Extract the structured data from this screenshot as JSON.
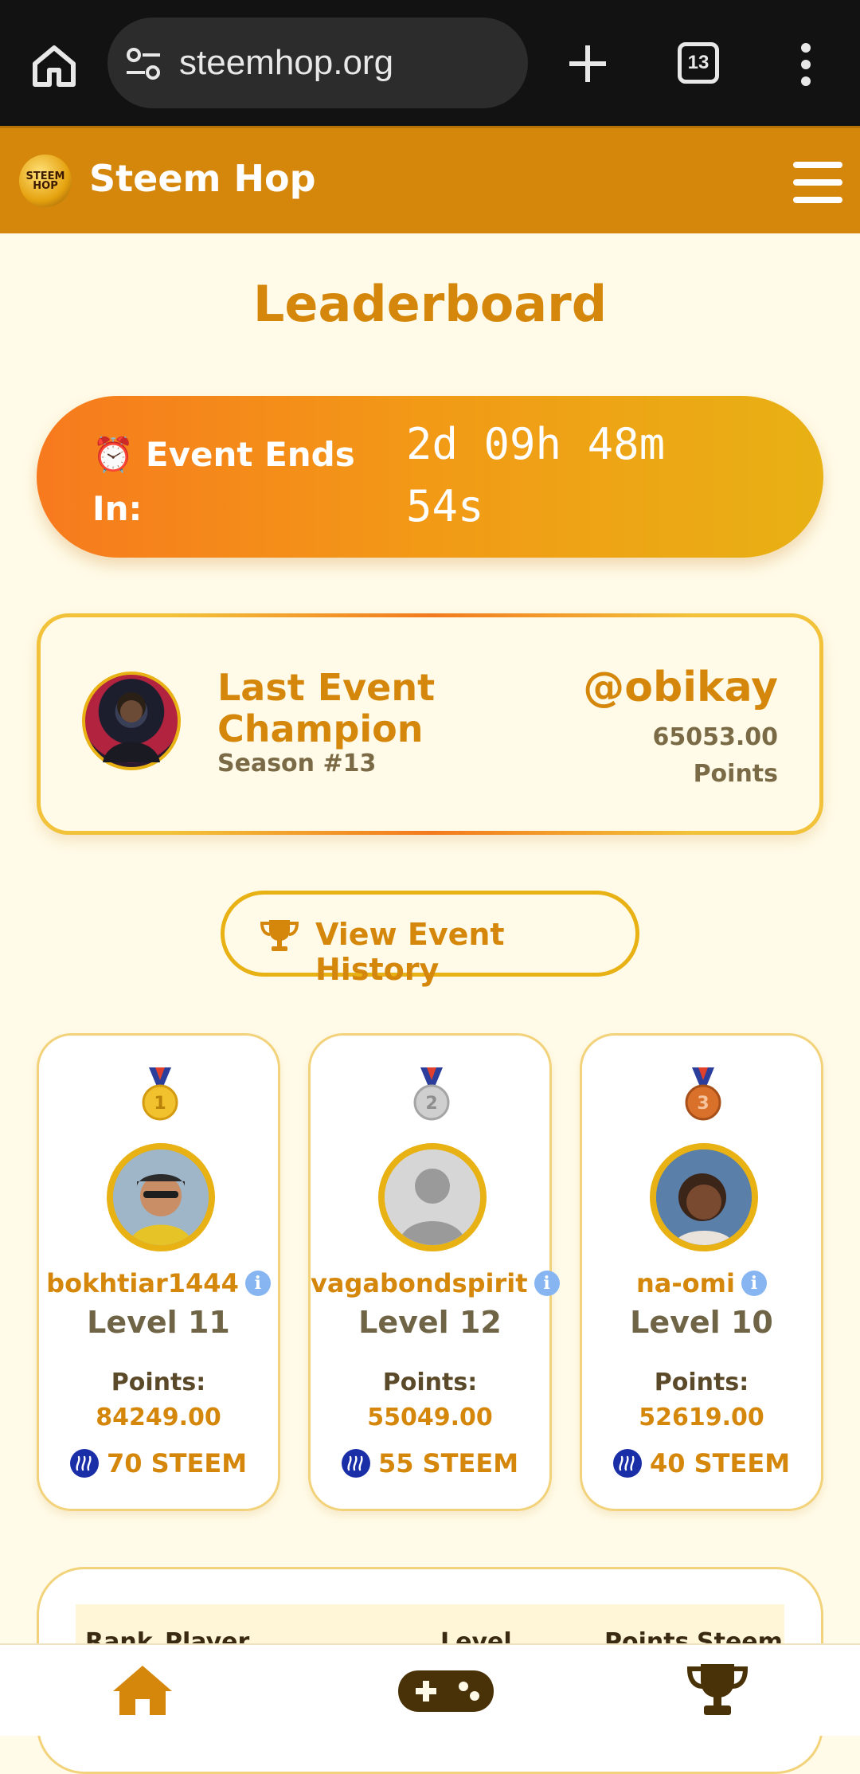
{
  "browser": {
    "url": "steemhop.org",
    "tab_count": "13",
    "icons": [
      "home-icon",
      "site-info-icon",
      "new-tab-plus-icon",
      "tabs-icon",
      "more-vert-icon"
    ]
  },
  "header": {
    "brand": "Steem Hop",
    "logo_text": "STEEM HOP",
    "icons": [
      "logo",
      "hamburger-menu-icon"
    ]
  },
  "page": {
    "title": "Leaderboard"
  },
  "timer": {
    "label_line1": "⏰ Event Ends",
    "label_line2": "In:",
    "value_line1": "2d 09h 48m",
    "value_line2": "54s"
  },
  "champion": {
    "title_line1": "Last Event",
    "title_line2": "Champion",
    "season": "Season #13",
    "username": "@obikay",
    "points_value": "65053.00",
    "points_label": "Points"
  },
  "history_button": {
    "label": "View Event History",
    "icon": "trophy-icon"
  },
  "podium": [
    {
      "rank": "1",
      "medal_color": "#f2c12e",
      "username": "bokhtiar1444",
      "level": "Level 11",
      "points_label": "Points:",
      "points": "84249.00",
      "reward": "70 STEEM"
    },
    {
      "rank": "2",
      "medal_color": "#c4c4c4",
      "username": "vagabondspirit",
      "level": "Level 12",
      "points_label": "Points:",
      "points": "55049.00",
      "reward": "55 STEEM"
    },
    {
      "rank": "3",
      "medal_color": "#d9712b",
      "username": "na-omi",
      "level": "Level 10",
      "points_label": "Points:",
      "points": "52619.00",
      "reward": "40 STEEM"
    }
  ],
  "table": {
    "columns": [
      "Rank",
      "Player",
      "Level",
      "Points",
      "Steem"
    ]
  },
  "bottom_nav": {
    "items": [
      "home-icon",
      "gamepad-icon",
      "trophy-icon"
    ]
  },
  "colors": {
    "accent": "#d4870a",
    "gold_border": "#e8b114",
    "background": "#fffbe8"
  }
}
